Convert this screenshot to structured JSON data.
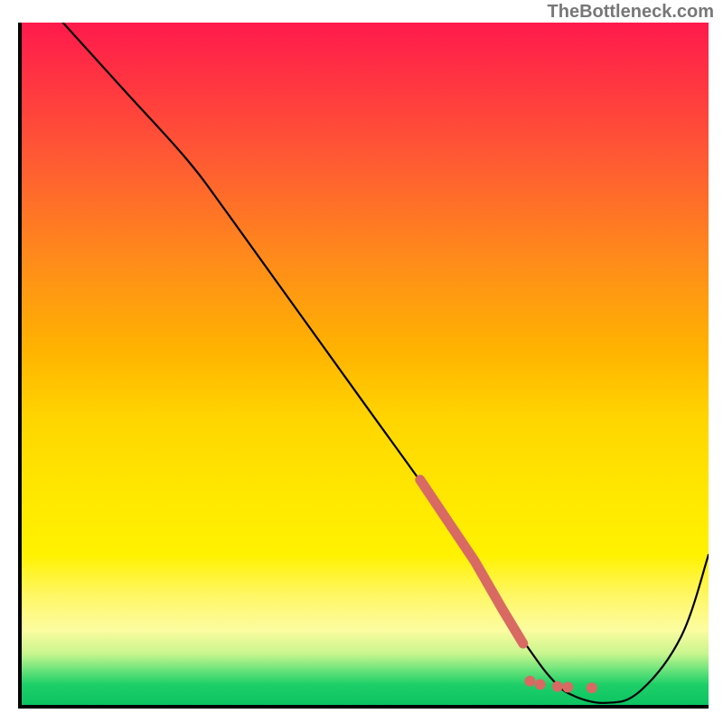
{
  "watermark": "TheBottleneck.com",
  "chart_data": {
    "type": "line",
    "title": "",
    "xlabel": "",
    "ylabel": "",
    "xlim": [
      0,
      100
    ],
    "ylim": [
      0,
      100
    ],
    "series": [
      {
        "name": "bottleneck-curve",
        "style": "solid-black",
        "x": [
          6,
          15,
          24,
          30,
          40,
          50,
          60,
          66,
          70,
          74,
          77,
          80,
          85,
          90,
          96,
          100
        ],
        "y": [
          100,
          90,
          80,
          72,
          58,
          44,
          30,
          21,
          14,
          8,
          4,
          1.5,
          0.3,
          2,
          10,
          22
        ]
      },
      {
        "name": "highlight-segment",
        "style": "thick-coral-solid",
        "x": [
          58,
          62,
          66,
          70,
          73
        ],
        "y": [
          33,
          27,
          21,
          14,
          9
        ]
      },
      {
        "name": "highlight-dots",
        "style": "coral-dots",
        "points": [
          {
            "x": 74,
            "y": 3.5
          },
          {
            "x": 75.5,
            "y": 3
          },
          {
            "x": 78,
            "y": 2.7
          },
          {
            "x": 79.5,
            "y": 2.6
          },
          {
            "x": 83,
            "y": 2.5
          }
        ]
      }
    ],
    "gradient_stops": [
      {
        "pos": 0,
        "color": "#ff1a4c"
      },
      {
        "pos": 0.35,
        "color": "#ff8c1a"
      },
      {
        "pos": 0.68,
        "color": "#ffe600"
      },
      {
        "pos": 0.9,
        "color": "#fcfca0"
      },
      {
        "pos": 1.0,
        "color": "#0cc462"
      }
    ]
  }
}
